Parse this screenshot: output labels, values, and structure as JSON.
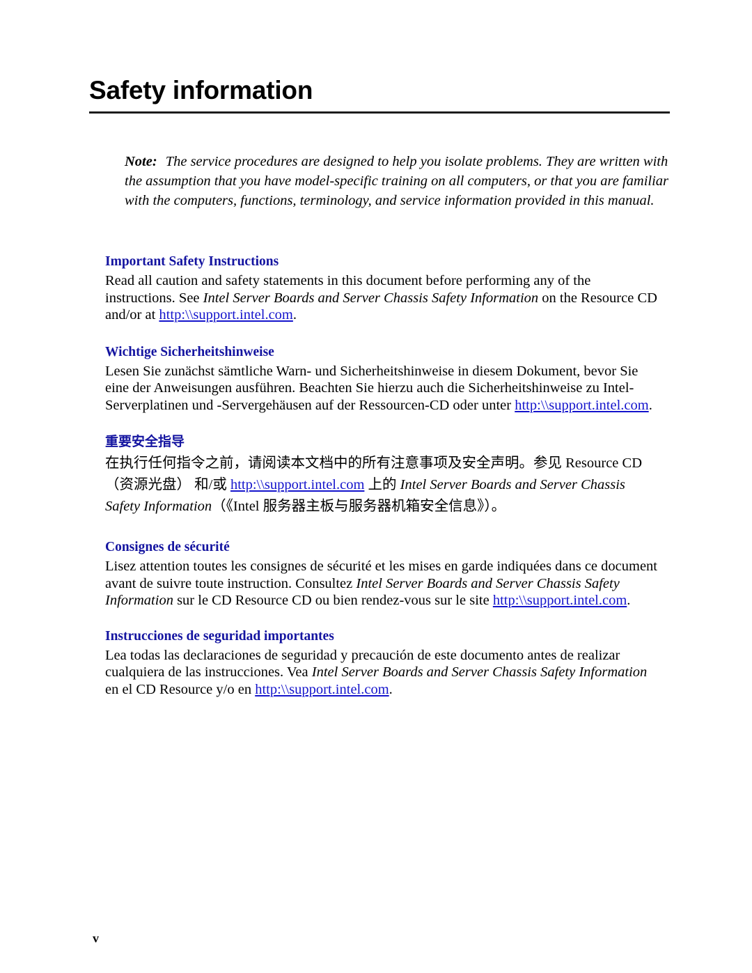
{
  "document": {
    "title": "Safety information",
    "page_number": "v"
  },
  "note": {
    "label": "Note:",
    "text": "The service procedures are designed to help you isolate problems. They are written with the assumption that you have model-specific training on all computers, or that you are familiar with the computers, functions, terminology, and service information provided in this manual."
  },
  "link_url": "http:\\\\support.intel.com",
  "colors": {
    "heading_blue": "#1414a0",
    "link_blue": "#1414cc",
    "text_black": "#000000",
    "rule_dark": "#1c1c1c"
  },
  "sections": [
    {
      "id": "en",
      "heading": "Important Safety Instructions",
      "body_parts": [
        {
          "type": "text",
          "value": "Read all caution and safety statements in this document before performing any of the instructions.  See "
        },
        {
          "type": "italic",
          "value": "Intel Server Boards and Server Chassis Safety Information"
        },
        {
          "type": "text",
          "value": " on the Resource CD and/or at "
        },
        {
          "type": "link",
          "value": "http:\\\\support.intel.com"
        },
        {
          "type": "text",
          "value": "."
        }
      ]
    },
    {
      "id": "de",
      "heading": "Wichtige Sicherheitshinweise",
      "body_parts": [
        {
          "type": "text",
          "value": "Lesen Sie zunächst sämtliche Warn- und Sicherheitshinweise in diesem Dokument, bevor Sie eine der Anweisungen ausführen. Beachten Sie hierzu auch die Sicherheitshinweise zu Intel-Serverplatinen und -Servergehäusen auf der Ressourcen-CD oder unter "
        },
        {
          "type": "link",
          "value": "http:\\\\support.intel.com"
        },
        {
          "type": "text",
          "value": "."
        }
      ]
    },
    {
      "id": "cn",
      "heading": "重要安全指导",
      "body_parts": [
        {
          "type": "text",
          "value": "在执行任何指令之前，请阅读本文档中的所有注意事项及安全声明。参见 Resource CD（资源光盘） 和/或 "
        },
        {
          "type": "link",
          "value": "http:\\\\support.intel.com"
        },
        {
          "type": "text",
          "value": " 上的 "
        },
        {
          "type": "italic",
          "value": "Intel Server Boards and Server Chassis Safety Information"
        },
        {
          "type": "text",
          "value": "（《Intel 服务器主板与服务器机箱安全信息》）。"
        }
      ]
    },
    {
      "id": "fr",
      "heading": "Consignes de sécurité",
      "body_parts": [
        {
          "type": "text",
          "value": "Lisez attention toutes les consignes de sécurité et les mises en garde indiquées dans ce document avant de suivre toute instruction. Consultez "
        },
        {
          "type": "italic",
          "value": "Intel Server Boards and Server Chassis Safety Information"
        },
        {
          "type": "text",
          "value": " sur le CD Resource CD ou bien rendez-vous sur le site "
        },
        {
          "type": "link",
          "value": "http:\\\\support.intel.com"
        },
        {
          "type": "text",
          "value": "."
        }
      ]
    },
    {
      "id": "es",
      "heading": "Instrucciones de seguridad importantes",
      "body_parts": [
        {
          "type": "text",
          "value": "Lea todas las declaraciones de seguridad y precaución de este documento antes de realizar cualquiera de las instrucciones.  Vea "
        },
        {
          "type": "italic",
          "value": "Intel Server Boards and Server Chassis Safety Information"
        },
        {
          "type": "text",
          "value": " en el CD Resource y/o en "
        },
        {
          "type": "link",
          "value": "http:\\\\support.intel.com"
        },
        {
          "type": "text",
          "value": "."
        }
      ]
    }
  ]
}
